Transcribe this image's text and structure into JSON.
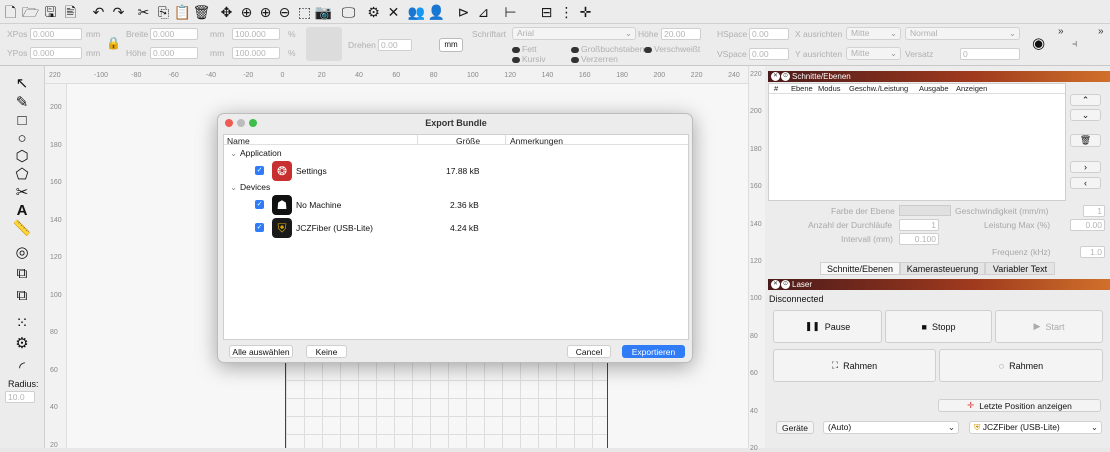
{
  "toolbar2": {
    "xpos_label": "XPos",
    "xpos_value": "0.000",
    "ypos_label": "YPos",
    "ypos_value": "0.000",
    "unit_mm": "mm",
    "unit_pct": "%",
    "width_label": "Breite",
    "width_value": "0.000",
    "height_label": "Höhe",
    "height_value": "0.000",
    "scale_x": "100.000",
    "scale_y": "100.000",
    "rotate_label": "Drehen",
    "rotate_value": "0.00",
    "mm_button": "mm",
    "font_label": "Schriftart",
    "font_value": "Arial",
    "font_height_label": "Höhe",
    "font_height_value": "20.00",
    "bold_label": "Fett",
    "italic_label": "Kursiv",
    "caps_label": "Großbuchstaben",
    "distort_label": "Verzerren",
    "welded_label": "Verschweißt",
    "hspace_label": "HSpace",
    "hspace_value": "0.00",
    "vspace_label": "VSpace",
    "vspace_value": "0.00",
    "xalign_label": "X ausrichten",
    "xalign_value": "Mitte",
    "yalign_label": "Y ausrichten",
    "yalign_value": "Mitte",
    "style_value": "Normal",
    "offset_label": "Versatz",
    "offset_value": "0"
  },
  "left_tools": {
    "radius_label": "Radius:",
    "radius_value": "10.0"
  },
  "hruler_ticks": [
    "220",
    "-100",
    "-80",
    "-60",
    "-40",
    "-20",
    "0",
    "20",
    "40",
    "60",
    "80",
    "100",
    "120",
    "140",
    "160",
    "180",
    "200",
    "220",
    "240"
  ],
  "vruler_ticks": [
    "200",
    "180",
    "160",
    "140",
    "120",
    "100",
    "80",
    "60",
    "40",
    "20"
  ],
  "vruler2_ticks": [
    "220",
    "200",
    "180",
    "160",
    "140",
    "120",
    "100",
    "80",
    "60",
    "40",
    "20"
  ],
  "cuts_panel": {
    "title": "Schnitte/Ebenen",
    "columns": [
      "#",
      "Ebene",
      "Modus",
      "Geschw./Leistung",
      "Ausgabe",
      "Anzeigen"
    ],
    "layer_color_label": "Farbe der Ebene",
    "speed_label": "Geschwindigkeit (mm/m)",
    "speed_value": "1",
    "passes_label": "Anzahl der Durchläufe",
    "passes_value": "1",
    "power_max_label": "Leistung Max (%)",
    "power_max_value": "0.00",
    "interval_label": "Intervall (mm)",
    "interval_value": "0.100",
    "frequency_label": "Frequenz (kHz)",
    "frequency_value": "1.0",
    "tabs": [
      "Schnitte/Ebenen",
      "Kamerasteuerung",
      "Variabler Text"
    ]
  },
  "laser_panel": {
    "title": "Laser",
    "status": "Disconnected",
    "pause": "Pause",
    "stop": "Stopp",
    "start": "Start",
    "frame1": "Rahmen",
    "frame2": "Rahmen",
    "last_position": "Letzte Position anzeigen",
    "devices_button": "Geräte",
    "port_value": "(Auto)",
    "device_value": "JCZFiber (USB-Lite)"
  },
  "dialog": {
    "title": "Export Bundle",
    "col_name": "Name",
    "col_size": "Größe",
    "col_notes": "Anmerkungen",
    "group_application": "Application",
    "group_devices": "Devices",
    "items": [
      {
        "name": "Settings",
        "size": "17.88 kB"
      },
      {
        "name": "No Machine",
        "size": "2.36 kB"
      },
      {
        "name": "JCZFiber (USB-Lite)",
        "size": "4.24 kB"
      }
    ],
    "select_all": "Alle auswählen",
    "none": "Keine",
    "cancel": "Cancel",
    "export": "Exportieren",
    "accent": "#2f7cf6"
  }
}
